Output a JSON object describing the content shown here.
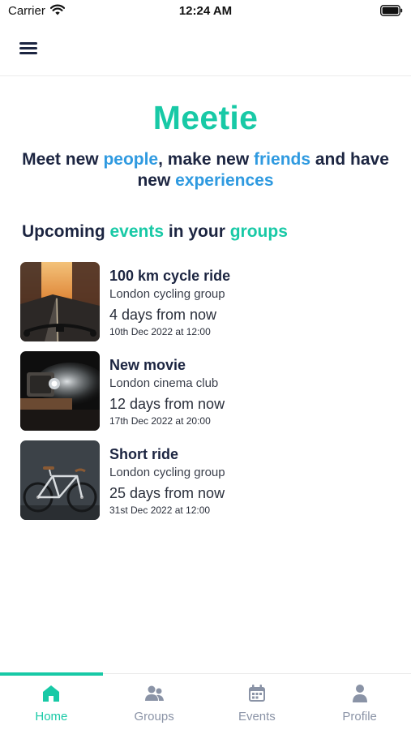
{
  "status_bar": {
    "carrier": "Carrier",
    "time": "12:24 AM"
  },
  "app": {
    "title": "Meetie",
    "tagline": {
      "p1": "Meet new ",
      "h1": "people",
      "p2": ", make new ",
      "h2": "friends",
      "p3": " and have new ",
      "h3": "experiences"
    }
  },
  "section": {
    "p1": "Upcoming ",
    "h1": "events",
    "p2": " in your ",
    "h2": "groups"
  },
  "events": [
    {
      "title": "100 km cycle ride",
      "group": "London cycling group",
      "relative": "4 days from now",
      "datetime": "10th Dec 2022 at 12:00",
      "image_icon": "cycling-road-photo"
    },
    {
      "title": "New movie",
      "group": "London cinema club",
      "relative": "12 days from now",
      "datetime": "17th Dec 2022 at 20:00",
      "image_icon": "film-projector-photo"
    },
    {
      "title": "Short ride",
      "group": "London cycling group",
      "relative": "25 days from now",
      "datetime": "31st Dec 2022 at 12:00",
      "image_icon": "bicycle-photo"
    }
  ],
  "tabs": [
    {
      "label": "Home",
      "icon": "home-icon",
      "active": true
    },
    {
      "label": "Groups",
      "icon": "groups-icon",
      "active": false
    },
    {
      "label": "Events",
      "icon": "calendar-icon",
      "active": false
    },
    {
      "label": "Profile",
      "icon": "person-icon",
      "active": false
    }
  ],
  "colors": {
    "brand_teal": "#18c9a6",
    "accent_blue": "#2f9ae0",
    "text_dark": "#1c2541",
    "tab_inactive": "#8a93a6"
  }
}
